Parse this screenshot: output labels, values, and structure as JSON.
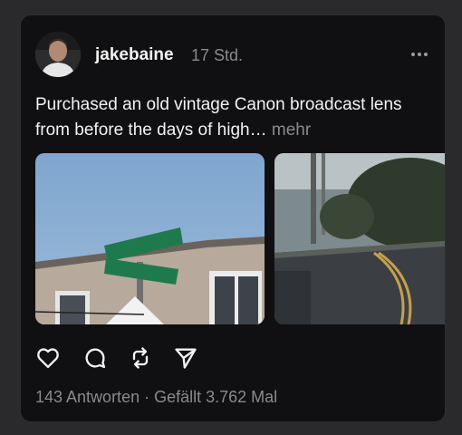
{
  "post": {
    "username": "jakebaine",
    "timestamp": "17 Std.",
    "text": "Purchased an old vintage Canon broadcast lens from before the days of high…",
    "more_label": "mehr",
    "replies": "143 Antworten",
    "separator": " · ",
    "likes": "Gefällt 3.762 Mal"
  },
  "icons": {
    "more": "more-horizontal-icon",
    "like": "heart-icon",
    "reply": "comment-bubble-icon",
    "repost": "repost-arrows-icon",
    "share": "send-paper-plane-icon"
  },
  "colors": {
    "background": "#101012",
    "primary_text": "#f2f2f2",
    "secondary_text": "#8a8a8e"
  }
}
